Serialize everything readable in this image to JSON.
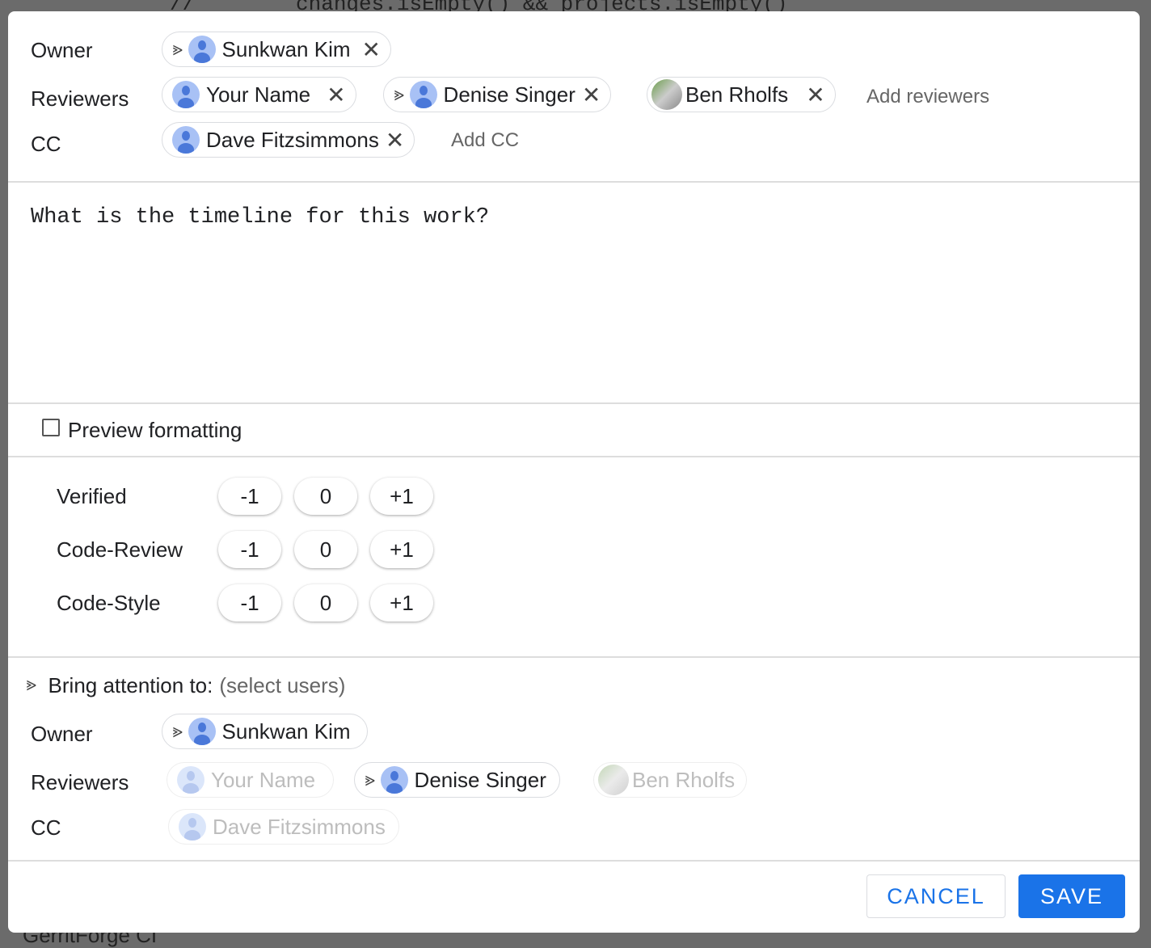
{
  "background": {
    "code_line": "//        changes.isEmpty() && projects.isEmpty()",
    "footer_text": "GerritForge CI"
  },
  "header": {
    "owner_label": "Owner",
    "reviewers_label": "Reviewers",
    "cc_label": "CC",
    "owner": {
      "name": "Sunkwan Kim",
      "attention": true
    },
    "reviewers": [
      {
        "name": "Your Name",
        "attention": false
      },
      {
        "name": "Denise Singer",
        "attention": true
      },
      {
        "name": "Ben Rholfs",
        "attention": false,
        "avatar": "photo"
      }
    ],
    "cc": [
      {
        "name": "Dave Fitzsimmons"
      }
    ],
    "add_reviewers": "Add reviewers",
    "add_cc": "Add CC",
    "remove_icon": "✕",
    "attention_icon": "⪢"
  },
  "message": "What is the timeline for this work?",
  "preview_formatting": {
    "label": "Preview formatting",
    "checked": false
  },
  "labels": [
    {
      "name": "Verified",
      "values": [
        "-1",
        "0",
        "+1"
      ]
    },
    {
      "name": "Code-Review",
      "values": [
        "-1",
        "0",
        "+1"
      ]
    },
    {
      "name": "Code-Style",
      "values": [
        "-1",
        "0",
        "+1"
      ]
    }
  ],
  "attention": {
    "title": "Bring attention to:",
    "hint": "(select users)",
    "owner_label": "Owner",
    "reviewers_label": "Reviewers",
    "cc_label": "CC",
    "owner": "Sunkwan Kim",
    "reviewers": [
      "Your Name",
      "Denise Singer",
      "Ben Rholfs"
    ],
    "cc": "Dave Fitzsimmons"
  },
  "actions": {
    "cancel": "CANCEL",
    "save": "SAVE"
  },
  "colors": {
    "accent": "#1a73e8"
  }
}
